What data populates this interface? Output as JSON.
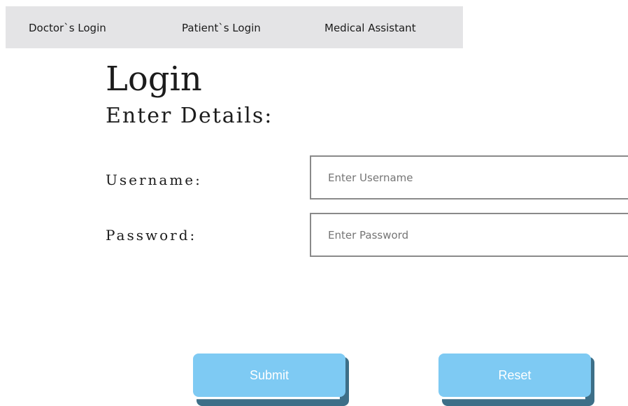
{
  "nav": {
    "items": [
      {
        "label": "Doctor`s Login"
      },
      {
        "label": "Patient`s Login"
      },
      {
        "label": "Medical Assistant"
      }
    ]
  },
  "form": {
    "title": "Login",
    "subtitle": "Enter Details:",
    "username_label": "Username:",
    "username_placeholder": "Enter Username",
    "username_value": "",
    "password_label": "Password:",
    "password_placeholder": "Enter Password",
    "password_value": ""
  },
  "buttons": {
    "submit_label": "Submit",
    "reset_label": "Reset"
  },
  "colors": {
    "nav_background": "#e4e4e6",
    "button_face": "#7ecaf3",
    "button_shadow": "#3d6f88",
    "input_border": "#8a8a8a"
  }
}
